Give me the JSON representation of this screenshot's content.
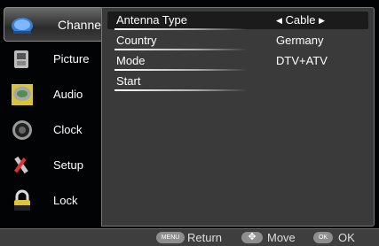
{
  "sidebar": {
    "items": [
      {
        "label": "Channel",
        "icon": "satellite-dish-icon",
        "active": true
      },
      {
        "label": "Picture",
        "icon": "tv-picture-icon",
        "active": false
      },
      {
        "label": "Audio",
        "icon": "audio-speaker-icon",
        "active": false
      },
      {
        "label": "Clock",
        "icon": "clock-icon",
        "active": false
      },
      {
        "label": "Setup",
        "icon": "setup-tools-icon",
        "active": false
      },
      {
        "label": "Lock",
        "icon": "padlock-icon",
        "active": false
      }
    ]
  },
  "menu": {
    "rows": [
      {
        "name": "Antenna Type",
        "value": "Cable"
      },
      {
        "name": "Country",
        "value": "Germany"
      },
      {
        "name": "Mode",
        "value": "DTV+ATV"
      },
      {
        "name": "Start",
        "value": ""
      }
    ]
  },
  "footer": {
    "return_key": "MENU",
    "return_label": "Return",
    "move_key": "✥",
    "move_label": "Move",
    "ok_key": "OK",
    "ok_label": "OK"
  }
}
